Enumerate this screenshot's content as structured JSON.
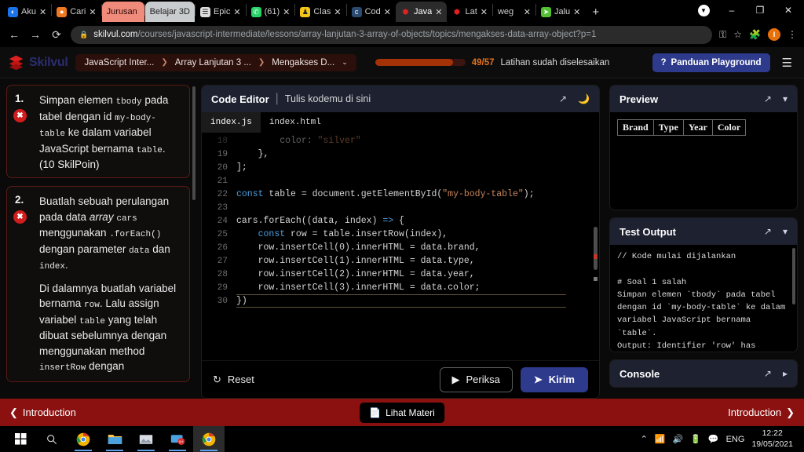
{
  "browser": {
    "tabs": [
      {
        "title": "Aku",
        "favicon": "globe-icon",
        "style": "normal",
        "active": false
      },
      {
        "title": "Cari",
        "favicon": "orange-icon",
        "style": "normal",
        "active": false
      },
      {
        "title": "Jurusan",
        "favicon": "none",
        "style": "pinned-red",
        "active": false
      },
      {
        "title": "Belajar 3D",
        "favicon": "none",
        "style": "pinned-gray",
        "active": false
      },
      {
        "title": "Epic",
        "favicon": "doc-icon",
        "style": "normal",
        "active": false
      },
      {
        "title": "(61)",
        "favicon": "whatsapp-icon",
        "style": "normal",
        "active": false
      },
      {
        "title": "Clas",
        "favicon": "classroom-icon",
        "style": "normal",
        "active": false
      },
      {
        "title": "Cod",
        "favicon": "code-icon",
        "style": "normal",
        "active": false
      },
      {
        "title": "Java",
        "favicon": "skilvul-icon",
        "style": "normal",
        "active": true
      },
      {
        "title": "Lat",
        "favicon": "skilvul-icon",
        "style": "normal",
        "active": false
      },
      {
        "title": "weg",
        "favicon": "none",
        "style": "normal",
        "active": false
      },
      {
        "title": "Jalu",
        "favicon": "green-icon",
        "style": "normal",
        "active": false
      }
    ],
    "new_tab_label": "+",
    "window_controls": {
      "minimize": "–",
      "maximize": "❐",
      "close": "✕",
      "profile": "▼"
    },
    "nav": {
      "back": "←",
      "forward": "→",
      "reload": "⟳"
    },
    "url": {
      "lock_icon": "lock-icon",
      "host": "skilvul.com",
      "path": "/courses/javascript-intermediate/lessons/array-lanjutan-3-array-of-objects/topics/mengakses-data-array-object?p=1"
    },
    "omnibar_icons": {
      "key": "key-icon",
      "star": "star-icon",
      "extensions": "extensions-icon",
      "profile": "I",
      "menu": "⋮"
    }
  },
  "app_header": {
    "brand": "Skilvul",
    "breadcrumb": [
      {
        "label": "JavaScript Inter..."
      },
      {
        "label": "Array Lanjutan 3 ..."
      },
      {
        "label": "Mengakses D..."
      }
    ],
    "breadcrumb_separator": "❯",
    "breadcrumb_caret": "⌄",
    "progress": {
      "value": 49,
      "total": 57,
      "count_text": "49/57",
      "label": "Latihan sudah diselesaikan",
      "percent": 86
    },
    "guide_button": {
      "icon": "question-icon",
      "label": "Panduan Playground"
    },
    "menu_icon": "hamburger-icon"
  },
  "tasks": [
    {
      "number": "1.",
      "status_icon": "error-x-icon",
      "lines": [
        {
          "text": "Simpan elemen "
        },
        {
          "text": "tbody",
          "code": true
        },
        {
          "text": " pada tabel dengan id "
        },
        {
          "text": "my-body-table",
          "code": true
        },
        {
          "text": " ke dalam variabel JavaScript bernama "
        },
        {
          "text": "table",
          "code": true
        },
        {
          "text": "."
        }
      ],
      "points": "(10 SkilPoin)"
    },
    {
      "number": "2.",
      "status_icon": "error-x-icon",
      "paragraph1_parts": [
        {
          "text": "Buatlah sebuah perulangan pada data "
        },
        {
          "text": "array",
          "italic": true
        },
        {
          "text": " "
        },
        {
          "text": "cars",
          "code": true
        },
        {
          "text": " menggunakan "
        },
        {
          "text": ".forEach()",
          "code": true
        },
        {
          "text": " dengan parameter "
        },
        {
          "text": "data",
          "code": true
        },
        {
          "text": " dan "
        },
        {
          "text": "index",
          "code": true
        },
        {
          "text": "."
        }
      ],
      "paragraph2_parts": [
        {
          "text": "Di dalamnya buatlah variabel bernama "
        },
        {
          "text": "row",
          "code": true
        },
        {
          "text": ". Lalu assign variabel "
        },
        {
          "text": "table",
          "code": true
        },
        {
          "text": " yang telah dibuat sebelumnya dengan menggunakan method "
        },
        {
          "text": "insertRow",
          "code": true
        },
        {
          "text": " dengan"
        }
      ]
    }
  ],
  "editor": {
    "title": "Code Editor",
    "divider": "|",
    "subtitle": "Tulis kodemu di sini",
    "expand_icon": "expand-icon",
    "theme_icon": "moon-icon",
    "file_tabs": [
      {
        "label": "index.js",
        "active": true
      },
      {
        "label": "index.html",
        "active": false
      }
    ],
    "first_visible_line": 18,
    "code_lines": [
      {
        "num": "18",
        "text": "        color: \"silver\"",
        "partial": true
      },
      {
        "num": "19",
        "text": "    },"
      },
      {
        "num": "20",
        "text": "];"
      },
      {
        "num": "21",
        "text": ""
      },
      {
        "num": "22",
        "text": "const table = document.getElementById(\"my-body-table\");"
      },
      {
        "num": "23",
        "text": ""
      },
      {
        "num": "24",
        "text": "cars.forEach((data, index) => {"
      },
      {
        "num": "25",
        "text": "    const row = table.insertRow(index),"
      },
      {
        "num": "26",
        "text": "    row.insertCell(0).innerHTML = data.brand,"
      },
      {
        "num": "27",
        "text": "    row.insertCell(1).innerHTML = data.type,"
      },
      {
        "num": "28",
        "text": "    row.insertCell(2).innerHTML = data.year,"
      },
      {
        "num": "29",
        "text": "    row.insertCell(3).innerHTML = data.color;"
      },
      {
        "num": "30",
        "text": "})",
        "cursor": true
      }
    ],
    "actions": {
      "reset": {
        "icon": "refresh-icon",
        "label": "Reset"
      },
      "check": {
        "icon": "play-icon",
        "label": "Periksa"
      },
      "submit": {
        "icon": "send-icon",
        "label": "Kirim"
      }
    }
  },
  "preview": {
    "title": "Preview",
    "expand_icon": "expand-icon",
    "collapse_icon": "chevron-down-icon",
    "table_headers": [
      "Brand",
      "Type",
      "Year",
      "Color"
    ],
    "table_rows": []
  },
  "test_output": {
    "title": "Test Output",
    "expand_icon": "expand-icon",
    "collapse_icon": "chevron-down-icon",
    "lines": [
      "// Kode mulai dijalankan",
      "",
      "# Soal 1 salah",
      "Simpan elemen `tbody` pada tabel",
      "dengan id `my-body-table` ke dalam",
      "variabel JavaScript bernama",
      "`table`.",
      "Output: Identifier 'row' has"
    ]
  },
  "console": {
    "title": "Console",
    "expand_icon": "expand-icon",
    "collapse_icon": "chevron-right-icon"
  },
  "lesson_nav": {
    "prev": {
      "icon": "chevron-left-icon",
      "label": "Introduction"
    },
    "materi": {
      "icon": "document-icon",
      "label": "Lihat Materi"
    },
    "next": {
      "icon": "chevron-right-icon",
      "label": "Introduction"
    }
  },
  "taskbar": {
    "start_icon": "windows-icon",
    "search_icon": "search-icon",
    "apps": [
      {
        "name": "chrome-icon",
        "running": true,
        "focused": false
      },
      {
        "name": "file-explorer-icon",
        "running": true,
        "focused": false
      },
      {
        "name": "photos-icon",
        "running": true,
        "focused": false
      },
      {
        "name": "messaging-icon",
        "running": true,
        "focused": false,
        "badge": "9+"
      },
      {
        "name": "chrome-icon",
        "running": true,
        "focused": true
      }
    ],
    "tray": {
      "chevron": "⌃",
      "wifi_icon": "wifi-icon",
      "volume_icon": "volume-icon",
      "battery_icon": "battery-icon",
      "notification_icon": "notification-icon",
      "language": "ENG"
    },
    "clock": {
      "time": "12:22",
      "date": "19/05/2021"
    }
  },
  "colors": {
    "brand_navy": "#2b2d6e",
    "accent_red": "#8b1111",
    "progress_orange": "#e2721f",
    "button_blue": "#2e3a8c",
    "error_red": "#d11d1d",
    "panel_header": "#1d2130"
  }
}
